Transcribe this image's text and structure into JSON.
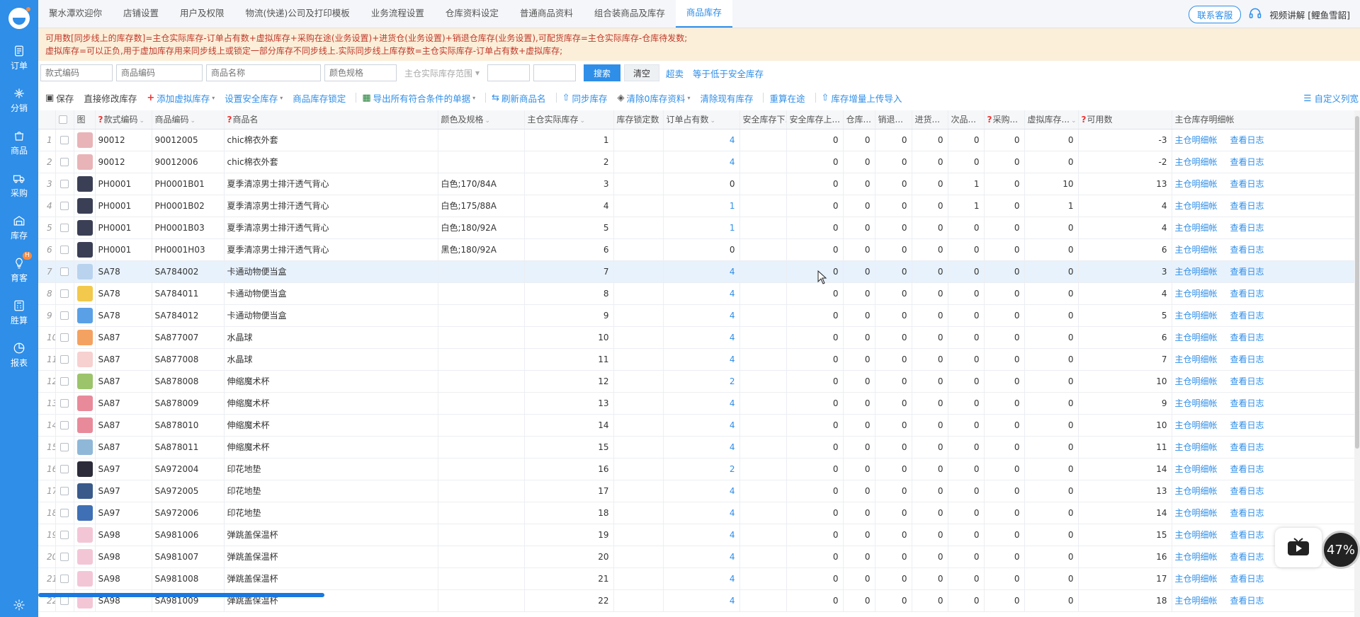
{
  "sidebar": {
    "items": [
      {
        "label": "订单",
        "icon": "order-icon"
      },
      {
        "label": "分销",
        "icon": "distribution-icon"
      },
      {
        "label": "商品",
        "icon": "product-icon"
      },
      {
        "label": "采购",
        "icon": "truck-icon"
      },
      {
        "label": "库存",
        "icon": "warehouse-icon"
      },
      {
        "label": "育客",
        "icon": "bulb-icon",
        "badge": "H"
      },
      {
        "label": "胜算",
        "icon": "calculator-icon"
      },
      {
        "label": "报表",
        "icon": "report-icon"
      }
    ],
    "settings_icon": "gear-icon"
  },
  "topbar": {
    "tabs": [
      "聚水潭欢迎你",
      "店铺设置",
      "用户及权限",
      "物流(快递)公司及打印模板",
      "业务流程设置",
      "仓库资料设定",
      "普通商品资料",
      "组合装商品及库存",
      "商品库存"
    ],
    "active_tab": 8,
    "customer_service": "联系客服",
    "user_label": "视频讲解 [鲤鱼雪韶]"
  },
  "notice": {
    "line1": "可用数[同步线上的库存数]=主仓实际库存-订单占有数+虚拟库存+采购在途(业务设置)+进货仓(业务设置)+销退仓库存(业务设置),可配货库存=主仓实际库存-仓库待发数;",
    "line2": "虚拟库存=可以正负,用于虚加库存用来同步线上或锁定一部分库存不同步线上.实际同步线上库存数=主仓实际库存-订单占有数+虚拟库存;"
  },
  "filters": {
    "style_code": "款式编码",
    "product_code": "商品编码",
    "product_name": "商品名称",
    "color_spec": "颜色规格",
    "range_select": "主仓实际库存范围",
    "search_btn": "搜索",
    "clear_btn": "清空",
    "oversell_link": "超卖",
    "below_safe_link": "等于低于安全库存"
  },
  "toolbar": {
    "save": "保存",
    "direct_edit": "直接修改库存",
    "add_virtual": "添加虚拟库存",
    "set_safe": "设置安全库存",
    "lock": "商品库存锁定",
    "export": "导出所有符合条件的单据",
    "refresh": "刷新商品名",
    "sync": "同步库存",
    "clear_zero": "清除0库存资料",
    "clear_existing": "清除现有库存",
    "recalc": "重算在途",
    "upload": "库存增量上传导入",
    "custom_cols": "自定义列宽"
  },
  "table": {
    "headers": {
      "img": "图",
      "style_code": "款式编码",
      "product_code": "商品编码",
      "product_name": "商品名",
      "color_spec": "颜色及规格",
      "main_stock": "主仓实际库存",
      "locked": "库存锁定数",
      "order_occupy": "订单占有数",
      "safe_low": "安全库存下...",
      "safe_high": "安全库存上...",
      "wh": "仓库...",
      "sale_ret": "销退...",
      "purchase_in": "进货...",
      "defect": "次品...",
      "purchase": "采购...",
      "virtual": "虚拟库存...",
      "available": "可用数",
      "detail": "主仓库存明细帐"
    },
    "op_detail": "主仓明细帐",
    "op_log": "查看日志",
    "rows": [
      {
        "idx": "1",
        "style": "90012",
        "code": "90012005",
        "name": "chic棉衣外套",
        "spec": "",
        "main": "1",
        "order": "4",
        "safe_high": "0",
        "wh": "0",
        "sr": "0",
        "pin": "0",
        "defect": "0",
        "pur": "0",
        "virt": "0",
        "avail": "-3",
        "thumb": "#e8b4b8"
      },
      {
        "idx": "2",
        "style": "90012",
        "code": "90012006",
        "name": "chic棉衣外套",
        "spec": "",
        "main": "2",
        "order": "4",
        "safe_high": "0",
        "wh": "0",
        "sr": "0",
        "pin": "0",
        "defect": "0",
        "pur": "0",
        "virt": "0",
        "avail": "-2",
        "thumb": "#e8b4b8"
      },
      {
        "idx": "3",
        "style": "PH0001",
        "code": "PH0001B01",
        "name": "夏季清凉男士排汗透气背心",
        "spec": "白色;170/84A",
        "main": "3",
        "order": "0",
        "safe_high": "0",
        "wh": "0",
        "sr": "0",
        "pin": "0",
        "defect": "1",
        "pur": "0",
        "virt": "10",
        "avail": "13",
        "thumb": "#3b3f55"
      },
      {
        "idx": "4",
        "style": "PH0001",
        "code": "PH0001B02",
        "name": "夏季清凉男士排汗透气背心",
        "spec": "白色;175/88A",
        "main": "4",
        "order": "1",
        "safe_high": "0",
        "wh": "0",
        "sr": "0",
        "pin": "0",
        "defect": "1",
        "pur": "0",
        "virt": "1",
        "avail": "4",
        "thumb": "#3b3f55"
      },
      {
        "idx": "5",
        "style": "PH0001",
        "code": "PH0001B03",
        "name": "夏季清凉男士排汗透气背心",
        "spec": "白色;180/92A",
        "main": "5",
        "order": "1",
        "safe_high": "0",
        "wh": "0",
        "sr": "0",
        "pin": "0",
        "defect": "0",
        "pur": "0",
        "virt": "0",
        "avail": "4",
        "thumb": "#3b3f55"
      },
      {
        "idx": "6",
        "style": "PH0001",
        "code": "PH0001H03",
        "name": "夏季清凉男士排汗透气背心",
        "spec": "黑色;180/92A",
        "main": "6",
        "order": "0",
        "safe_high": "0",
        "wh": "0",
        "sr": "0",
        "pin": "0",
        "defect": "0",
        "pur": "0",
        "virt": "0",
        "avail": "6",
        "thumb": "#3b3f55"
      },
      {
        "idx": "7",
        "style": "SA78",
        "code": "SA784002",
        "name": "卡通动物便当盒",
        "spec": "",
        "main": "7",
        "order": "4",
        "safe_high": "0",
        "wh": "0",
        "sr": "0",
        "pin": "0",
        "defect": "0",
        "pur": "0",
        "virt": "0",
        "avail": "3",
        "thumb": "#b9d3ee",
        "hl": true
      },
      {
        "idx": "8",
        "style": "SA78",
        "code": "SA784011",
        "name": "卡通动物便当盒",
        "spec": "",
        "main": "8",
        "order": "4",
        "safe_high": "0",
        "wh": "0",
        "sr": "0",
        "pin": "0",
        "defect": "0",
        "pur": "0",
        "virt": "0",
        "avail": "4",
        "thumb": "#f2c94c"
      },
      {
        "idx": "9",
        "style": "SA78",
        "code": "SA784012",
        "name": "卡通动物便当盒",
        "spec": "",
        "main": "9",
        "order": "4",
        "safe_high": "0",
        "wh": "0",
        "sr": "0",
        "pin": "0",
        "defect": "0",
        "pur": "0",
        "virt": "0",
        "avail": "5",
        "thumb": "#5aa0e6"
      },
      {
        "idx": "10",
        "style": "SA87",
        "code": "SA877007",
        "name": "水晶球",
        "spec": "",
        "main": "10",
        "order": "4",
        "safe_high": "0",
        "wh": "0",
        "sr": "0",
        "pin": "0",
        "defect": "0",
        "pur": "0",
        "virt": "0",
        "avail": "6",
        "thumb": "#f4a261"
      },
      {
        "idx": "11",
        "style": "SA87",
        "code": "SA877008",
        "name": "水晶球",
        "spec": "",
        "main": "11",
        "order": "4",
        "safe_high": "0",
        "wh": "0",
        "sr": "0",
        "pin": "0",
        "defect": "0",
        "pur": "0",
        "virt": "0",
        "avail": "7",
        "thumb": "#f7d0d0"
      },
      {
        "idx": "12",
        "style": "SA87",
        "code": "SA878008",
        "name": "伸缩魔术杯",
        "spec": "",
        "main": "12",
        "order": "2",
        "safe_high": "0",
        "wh": "0",
        "sr": "0",
        "pin": "0",
        "defect": "0",
        "pur": "0",
        "virt": "0",
        "avail": "10",
        "thumb": "#9cc46b"
      },
      {
        "idx": "13",
        "style": "SA87",
        "code": "SA878009",
        "name": "伸缩魔术杯",
        "spec": "",
        "main": "13",
        "order": "4",
        "safe_high": "0",
        "wh": "0",
        "sr": "0",
        "pin": "0",
        "defect": "0",
        "pur": "0",
        "virt": "0",
        "avail": "9",
        "thumb": "#e88a9a"
      },
      {
        "idx": "14",
        "style": "SA87",
        "code": "SA878010",
        "name": "伸缩魔术杯",
        "spec": "",
        "main": "14",
        "order": "4",
        "safe_high": "0",
        "wh": "0",
        "sr": "0",
        "pin": "0",
        "defect": "0",
        "pur": "0",
        "virt": "0",
        "avail": "10",
        "thumb": "#e88a9a"
      },
      {
        "idx": "15",
        "style": "SA87",
        "code": "SA878011",
        "name": "伸缩魔术杯",
        "spec": "",
        "main": "15",
        "order": "4",
        "safe_high": "0",
        "wh": "0",
        "sr": "0",
        "pin": "0",
        "defect": "0",
        "pur": "0",
        "virt": "0",
        "avail": "11",
        "thumb": "#8fb8d8"
      },
      {
        "idx": "16",
        "style": "SA97",
        "code": "SA972004",
        "name": "印花地垫",
        "spec": "",
        "main": "16",
        "order": "2",
        "safe_high": "0",
        "wh": "0",
        "sr": "0",
        "pin": "0",
        "defect": "0",
        "pur": "0",
        "virt": "0",
        "avail": "14",
        "thumb": "#2b2b3a"
      },
      {
        "idx": "17",
        "style": "SA97",
        "code": "SA972005",
        "name": "印花地垫",
        "spec": "",
        "main": "17",
        "order": "4",
        "safe_high": "0",
        "wh": "0",
        "sr": "0",
        "pin": "0",
        "defect": "0",
        "pur": "0",
        "virt": "0",
        "avail": "13",
        "thumb": "#3a5a8a"
      },
      {
        "idx": "18",
        "style": "SA97",
        "code": "SA972006",
        "name": "印花地垫",
        "spec": "",
        "main": "18",
        "order": "4",
        "safe_high": "0",
        "wh": "0",
        "sr": "0",
        "pin": "0",
        "defect": "0",
        "pur": "0",
        "virt": "0",
        "avail": "14",
        "thumb": "#3f6fb5"
      },
      {
        "idx": "19",
        "style": "SA98",
        "code": "SA981006",
        "name": "弹跳盖保温杯",
        "spec": "",
        "main": "19",
        "order": "4",
        "safe_high": "0",
        "wh": "0",
        "sr": "0",
        "pin": "0",
        "defect": "0",
        "pur": "0",
        "virt": "0",
        "avail": "15",
        "thumb": "#f3c6d6"
      },
      {
        "idx": "20",
        "style": "SA98",
        "code": "SA981007",
        "name": "弹跳盖保温杯",
        "spec": "",
        "main": "20",
        "order": "4",
        "safe_high": "0",
        "wh": "0",
        "sr": "0",
        "pin": "0",
        "defect": "0",
        "pur": "0",
        "virt": "0",
        "avail": "16",
        "thumb": "#f3c6d6"
      },
      {
        "idx": "21",
        "style": "SA98",
        "code": "SA981008",
        "name": "弹跳盖保温杯",
        "spec": "",
        "main": "21",
        "order": "4",
        "safe_high": "0",
        "wh": "0",
        "sr": "0",
        "pin": "0",
        "defect": "0",
        "pur": "0",
        "virt": "0",
        "avail": "17",
        "thumb": "#f3c6d6"
      },
      {
        "idx": "22",
        "style": "SA98",
        "code": "SA981009",
        "name": "弹跳盖保温杯",
        "spec": "",
        "main": "22",
        "order": "4",
        "safe_high": "0",
        "wh": "0",
        "sr": "0",
        "pin": "0",
        "defect": "0",
        "pur": "0",
        "virt": "0",
        "avail": "18",
        "thumb": "#f3c6d6"
      }
    ]
  },
  "video_widget": {
    "percent": "47%"
  },
  "colors": {
    "brand": "#2e8ee8",
    "notice_bg": "#fbefd9",
    "notice_text": "#c0392b",
    "row_highlight": "#e8f2fd"
  }
}
